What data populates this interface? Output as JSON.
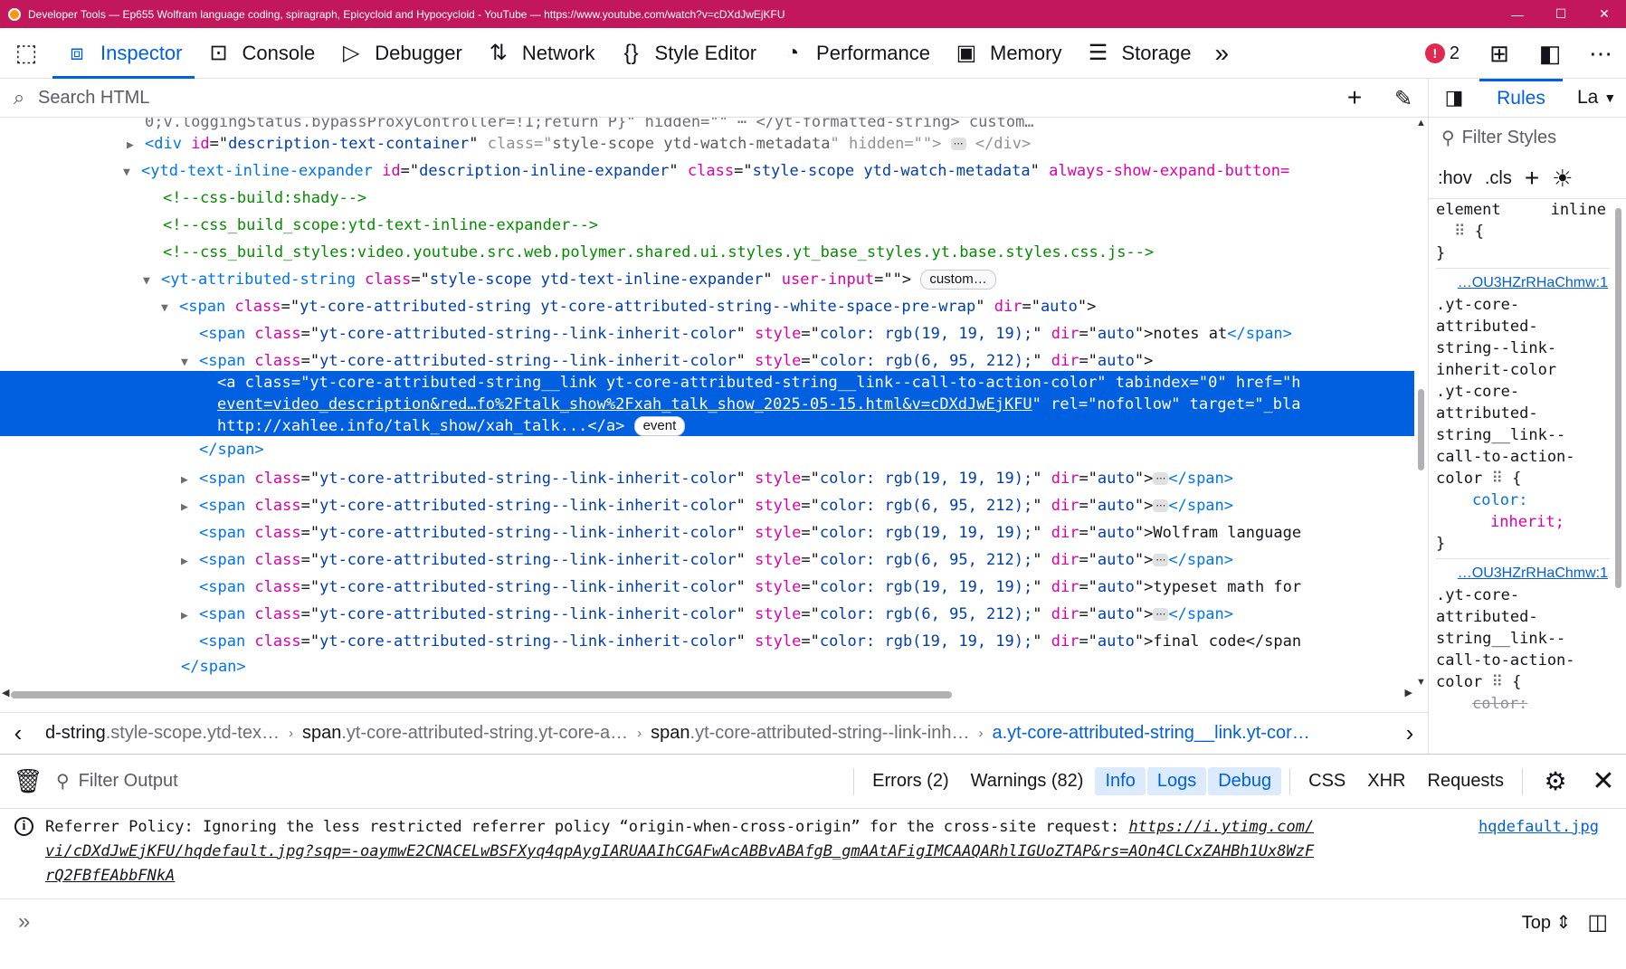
{
  "window": {
    "title": "Developer Tools — Ep655 Wolfram language coding, spiragraph, Epicycloid and Hypocycloid - YouTube — https://www.youtube.com/watch?v=cDXdJwEjKFU",
    "controls": [
      "—",
      "☐",
      "✕"
    ]
  },
  "toolbar": {
    "tabs": [
      {
        "label": "Inspector",
        "icon": "inspector-icon"
      },
      {
        "label": "Console",
        "icon": "console-icon"
      },
      {
        "label": "Debugger",
        "icon": "debugger-icon"
      },
      {
        "label": "Network",
        "icon": "network-icon"
      },
      {
        "label": "Style Editor",
        "icon": "style-editor-icon"
      },
      {
        "label": "Performance",
        "icon": "performance-icon"
      },
      {
        "label": "Memory",
        "icon": "memory-icon"
      },
      {
        "label": "Storage",
        "icon": "storage-icon"
      }
    ],
    "error_count": "2",
    "colors": {
      "accent": "#0060df",
      "titlebar": "#c2185b",
      "error": "#e22850"
    }
  },
  "search": {
    "placeholder": "Search HTML"
  },
  "markup": {
    "cut_line": "0;v.loggingStatus.bypassProxyController=!1;return P}\"  hidden=\"\" ⋯ </yt-formatted-string> custom…",
    "lines": {
      "l1": {
        "a": "<div ",
        "b": "id",
        "c": "=\"",
        "d": "description-text-container",
        "e": "\" ",
        "f": "class",
        "g": "=\"",
        "h": "style-scope ytd-watch-metadata",
        "i": "\" ",
        "j": "hidden",
        "k": "=\"\">",
        "l": "</div>"
      },
      "l2": {
        "a": "<ytd-text-inline-expander ",
        "b": "id",
        "c": "description-inline-expander",
        "d": "class",
        "e": "style-scope ytd-watch-metadata",
        "f": "always-show-expand-button="
      },
      "l3": "<!--css-build:shady-->",
      "l4": "<!--css_build_scope:ytd-text-inline-expander-->",
      "l5": "<!--css_build_styles:video.youtube.src.web.polymer.shared.ui.styles.yt_base_styles.yt.base.styles.css.js-->",
      "l6": {
        "a": "<yt-attributed-string ",
        "b": "class",
        "c": "style-scope ytd-text-inline-expander",
        "d": "user-input",
        "badge": "custom…"
      },
      "l7": {
        "a": "<span ",
        "b": "class",
        "c": "yt-core-attributed-string yt-core-attributed-string--white-space-pre-wrap",
        "d": "dir",
        "e": "auto"
      },
      "l8": {
        "cls": "yt-core-attributed-string--link-inherit-color",
        "style": "color: rgb(19, 19, 19);",
        "text": "notes at"
      },
      "l9": {
        "cls": "yt-core-attributed-string--link-inherit-color",
        "style": "color: rgb(6, 95, 212);"
      },
      "sel1": "<a class=\"yt-core-attributed-string__link yt-core-attributed-string__link--call-to-action-color\" tabindex=\"0\" href=\"h",
      "sel2a": "event=video_description&red…fo%2Ftalk_show%2Fxah_talk_show_2025-05-15.html&v=cDXdJwEjKFU",
      "sel2b": "\" rel=\"nofollow\" target=\"_bla",
      "sel3": "http://xahlee.info/talk_show/xah_talk...</a>",
      "sel_badge": "event",
      "close_span": "</span>",
      "rows": [
        {
          "twisty": true,
          "style": "color: rgb(19, 19, 19);",
          "text": ""
        },
        {
          "twisty": true,
          "style": "color: rgb(6, 95, 212);",
          "text": ""
        },
        {
          "twisty": false,
          "style": "color: rgb(19, 19, 19);",
          "text": "Wolfram language"
        },
        {
          "twisty": true,
          "style": "color: rgb(6, 95, 212);",
          "text": ""
        },
        {
          "twisty": false,
          "style": "color: rgb(19, 19, 19);",
          "text": "typeset math for"
        },
        {
          "twisty": true,
          "style": "color: rgb(6, 95, 212);",
          "text": ""
        },
        {
          "twisty": false,
          "style": "color: rgb(19, 19, 19);",
          "text": "final code</span"
        }
      ],
      "row_class": "yt-core-attributed-string--link-inherit-color",
      "last": "</span>"
    }
  },
  "breadcrumbs": [
    {
      "tag": "d-string",
      "cls": ".style-scope.ytd-tex…"
    },
    {
      "tag": "span",
      "cls": ".yt-core-attributed-string.yt-core-a…"
    },
    {
      "tag": "span",
      "cls": ".yt-core-attributed-string--link-inh…"
    },
    {
      "tag": "a",
      "cls": ".yt-core-attributed-string__link.yt-cor…"
    }
  ],
  "sidebar": {
    "tab_rules": "Rules",
    "tab_layout": "La",
    "filter_placeholder": "Filter Styles",
    "hov": ":hov",
    "cls": ".cls",
    "element_rule": {
      "selector": "element",
      "source": "inline",
      "open": "{",
      "close": "}"
    },
    "rule1": {
      "source": "…OU3HZrRHaChmw:1",
      "selector": [
        ".yt-core-",
        "attributed-",
        "string--link-",
        "inherit-color",
        ".yt-core-",
        "attributed-",
        "string__link--",
        "call-to-action-",
        "color"
      ],
      "prop": "color",
      "value": "inherit;"
    },
    "rule2": {
      "source": "…OU3HZrRHaChmw:1",
      "selector": [
        ".yt-core-",
        "attributed-",
        "string__link--",
        "call-to-action-",
        "color"
      ],
      "prop": "color:"
    }
  },
  "console": {
    "filter_placeholder": "Filter Output",
    "filters": [
      {
        "label": "Errors (2)",
        "on": false
      },
      {
        "label": "Warnings (82)",
        "on": false
      },
      {
        "label": "Info",
        "on": true
      },
      {
        "label": "Logs",
        "on": true
      },
      {
        "label": "Debug",
        "on": true
      },
      {
        "label": "CSS",
        "on": false
      },
      {
        "label": "XHR",
        "on": false
      },
      {
        "label": "Requests",
        "on": false
      }
    ],
    "message": {
      "text": "Referrer Policy: Ignoring the less restricted referrer policy “origin-when-cross-origin” for the cross-site request: ",
      "url1": "https://i.ytimg.com/",
      "url2": "vi/cDXdJwEjKFU/hqdefault.jpg?sqp=-oaymwE2CNACELwBSFXyq4qpAygIARUAAIhCGAFwAcABBvABAfgB_gmAAtAFigIMCAAQARhlIGUoZTAP&rs=AOn4CLCxZAHBh1Ux8WzF",
      "url3": "rQ2FBfEAbbFNkA",
      "source": "hqdefault.jpg"
    },
    "prompt_context": "Top"
  }
}
